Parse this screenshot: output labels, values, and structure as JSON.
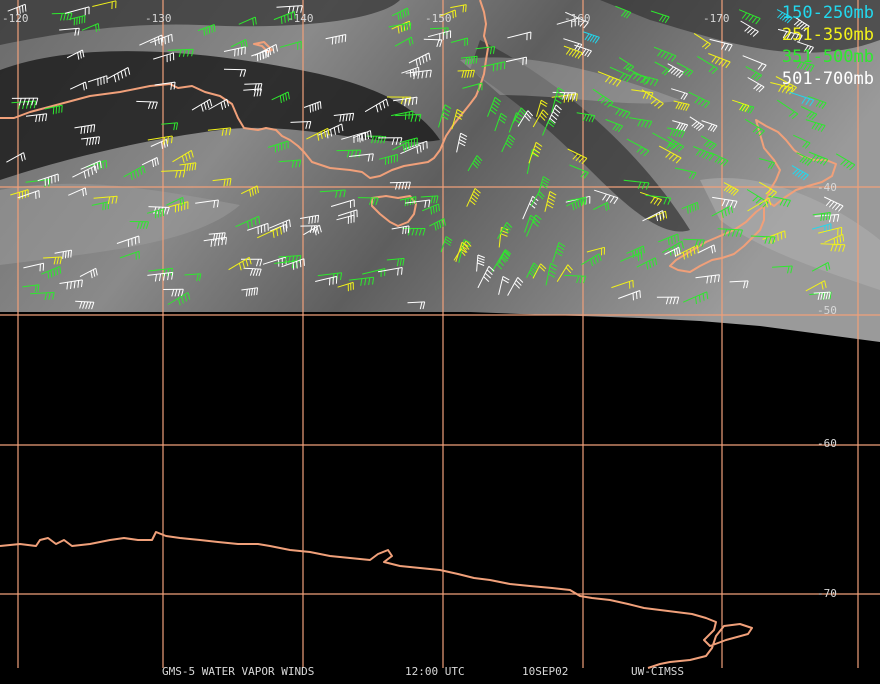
{
  "map": {
    "longitude_labels": [
      "-120",
      "-130",
      "-140",
      "-150",
      "-160",
      "-170"
    ],
    "latitude_labels": [
      "-40",
      "-50",
      "-60",
      "-70"
    ]
  },
  "legend": [
    {
      "label": "150-250mb",
      "color": "#22d8ee"
    },
    {
      "label": "251-350mb",
      "color": "#f2f21a"
    },
    {
      "label": "351-500mb",
      "color": "#2ee82e"
    },
    {
      "label": "501-700mb",
      "color": "#ffffff"
    }
  ],
  "footer": {
    "satellite": "GMS-5 WATER VAPOR WINDS",
    "time": "12:00 UTC",
    "date": "10SEP02",
    "source": "UW-CIMSS"
  },
  "colors": {
    "grid": "#f0a07a",
    "coast": "#f0a07a",
    "background": "#000000",
    "imagery": "#7a7a7a"
  }
}
